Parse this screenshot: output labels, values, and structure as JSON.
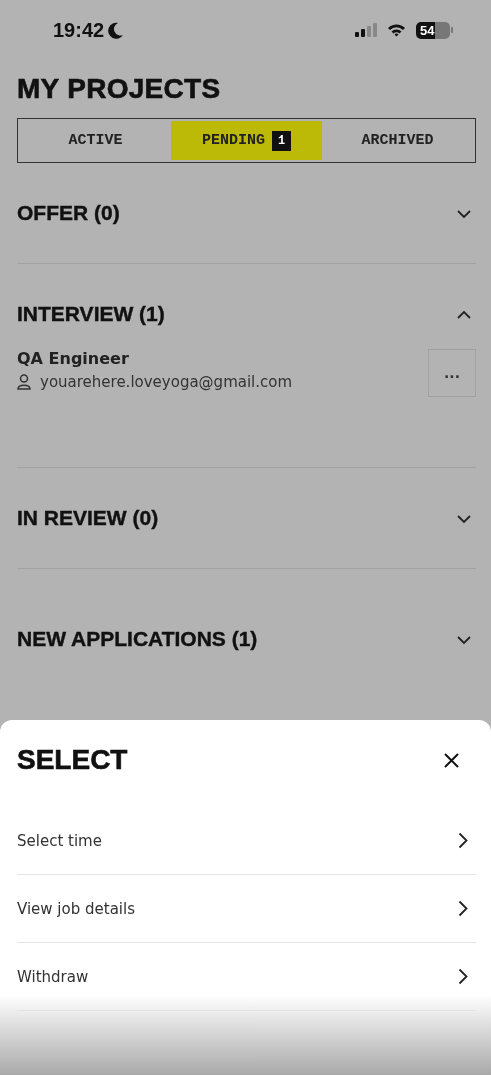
{
  "status_bar": {
    "time": "19:42",
    "battery": "54"
  },
  "title": "MY PROJECTS",
  "tabs": [
    {
      "label": "ACTIVE",
      "selected": false
    },
    {
      "label": "PENDING",
      "selected": true,
      "badge": "1"
    },
    {
      "label": "ARCHIVED",
      "selected": false
    }
  ],
  "sections": [
    {
      "title": "OFFER (0)",
      "expanded": false
    },
    {
      "title": "INTERVIEW (1)",
      "expanded": true,
      "items": [
        {
          "role": "QA Engineer",
          "email": "youarehere.loveyoga@gmail.com",
          "menu": "..."
        }
      ]
    },
    {
      "title": "IN REVIEW (0)",
      "expanded": false
    },
    {
      "title": "NEW APPLICATIONS (1)",
      "expanded": false
    }
  ],
  "sheet": {
    "title": "SELECT",
    "options": [
      {
        "label": "Select time"
      },
      {
        "label": "View job details"
      },
      {
        "label": "Withdraw"
      }
    ]
  }
}
